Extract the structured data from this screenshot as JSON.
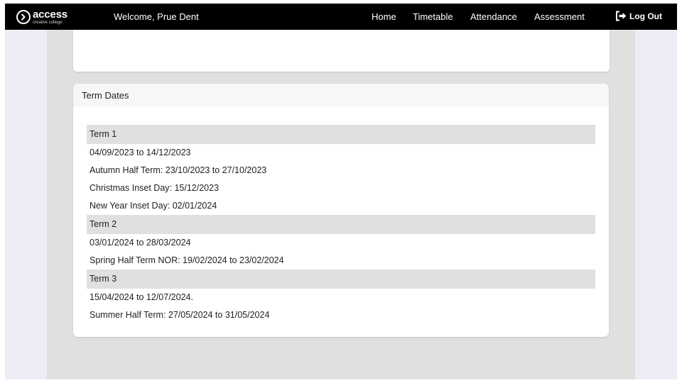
{
  "header": {
    "logo": {
      "main": "access",
      "sub": "creative college"
    },
    "welcome": "Welcome, Prue Dent",
    "nav": [
      "Home",
      "Timetable",
      "Attendance",
      "Assessment"
    ],
    "logout_label": "Log Out"
  },
  "term_dates": {
    "title": "Term Dates",
    "terms": [
      {
        "label": "Term 1",
        "rows": [
          "04/09/2023 to 14/12/2023",
          "Autumn Half Term: 23/10/2023 to 27/10/2023",
          "Christmas Inset Day: 15/12/2023",
          "New Year Inset Day: 02/01/2024"
        ]
      },
      {
        "label": "Term 2",
        "rows": [
          "03/01/2024 to 28/03/2024",
          "Spring Half Term NOR: 19/02/2024 to 23/02/2024"
        ]
      },
      {
        "label": "Term 3",
        "rows": [
          "15/04/2024 to 12/07/2024.",
          "Summer Half Term: 27/05/2024 to 31/05/2024"
        ]
      }
    ]
  }
}
